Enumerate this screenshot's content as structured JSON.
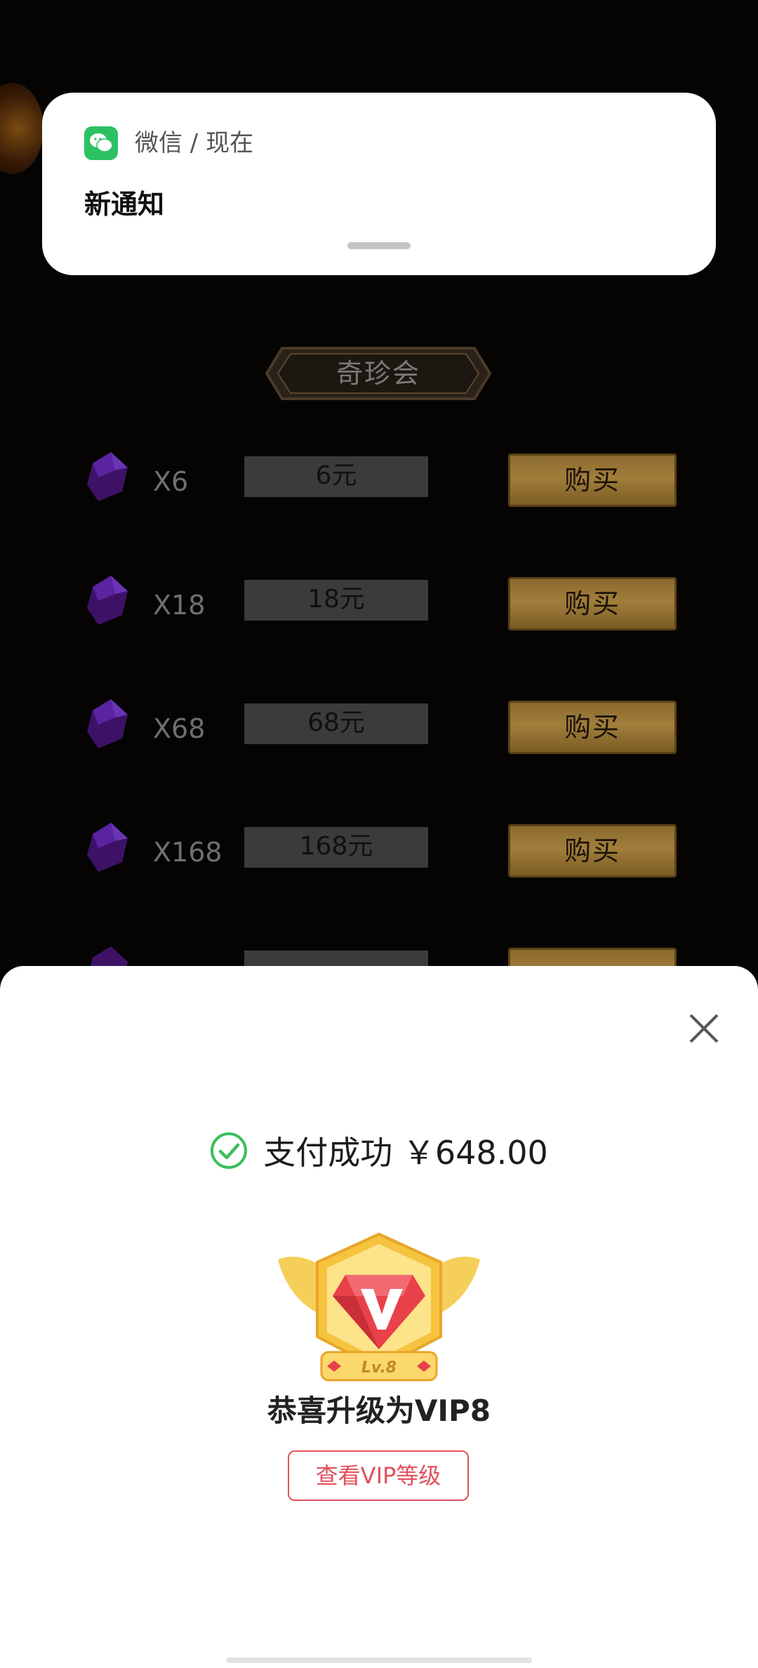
{
  "notification": {
    "app": "微信 / 现在",
    "title": "新通知"
  },
  "shop": {
    "title": "奇珍会",
    "items": [
      {
        "qty": "X6",
        "price": "6元",
        "buy": "购买"
      },
      {
        "qty": "X18",
        "price": "18元",
        "buy": "购买"
      },
      {
        "qty": "X68",
        "price": "68元",
        "buy": "购买"
      },
      {
        "qty": "X168",
        "price": "168元",
        "buy": "购买"
      }
    ]
  },
  "payment": {
    "status": "支付成功 ￥648.00",
    "badge_level": "Lv.8",
    "congrats": "恭喜升级为VIP8",
    "view_vip": "查看VIP等级"
  },
  "colors": {
    "wechat_green": "#2bc163",
    "success_green": "#3cbf5c",
    "vip_red": "#e2515c"
  }
}
